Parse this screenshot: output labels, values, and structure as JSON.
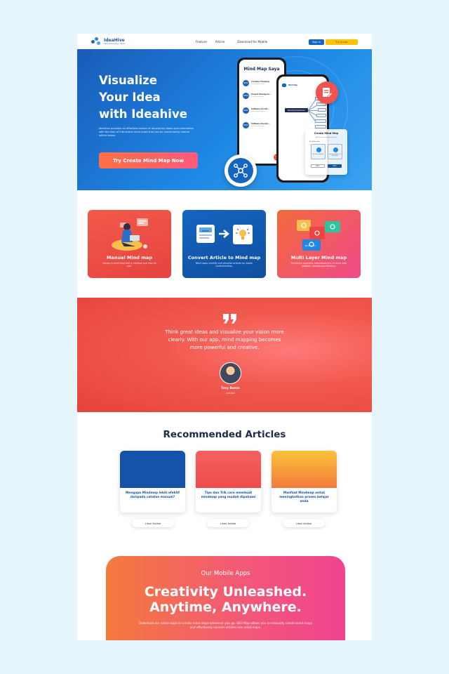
{
  "brand": {
    "name": "IdeaHive",
    "tagline": "Structure your mind",
    "accent": "#1565c0",
    "cta_color": "#ffc107"
  },
  "nav": {
    "links": [
      "Feature",
      "Article",
      "Download for Mobile"
    ],
    "signin_label": "Sign in",
    "try_label": "Try it now"
  },
  "hero": {
    "title_lines": [
      "Visualize",
      "Your Idea",
      "with Ideahive"
    ],
    "description": "IdeaHive provides an effortless means of structuring ideas and information with the help of interactive mind maps that can be conveniently shared within teams.",
    "cta_label": "Try Create Mind Map Now",
    "phone_list": {
      "title": "Mind Map Saya",
      "items": [
        {
          "badge": "MIND",
          "title": "Creative Planning",
          "sub": "Lorem ipsum dolor"
        },
        {
          "badge": "MIND",
          "title": "Project Managem...",
          "sub": "Lorem ipsum dolor"
        },
        {
          "badge": "MIND",
          "title": "Software Archit...",
          "sub": "Lorem ipsum dolor"
        },
        {
          "badge": "MIND",
          "title": "Software Develo...",
          "sub": "Lorem ipsum dolor"
        }
      ]
    },
    "phone_map": {
      "header": "Mind Map",
      "center_node": "Marketing Department"
    },
    "dialog": {
      "title": "Create Mind Map",
      "subtitle": "Type to start planning the path",
      "label": "Pick Mind map",
      "option_1": "Generate Manual",
      "option_2": "Generate Article to Mind map",
      "back_label": "Back",
      "next_label": "Next"
    }
  },
  "features": [
    {
      "title": "Manual Mind map",
      "desc": "Design a mind map that is intuitive and easy to use."
    },
    {
      "title": "Convert Article to Mind map",
      "desc": "Mind maps simplify and visualize articles for easier understanding."
    },
    {
      "title": "Multi Layer Mind map",
      "desc": "Facilitates seamless interconnection of mind map projects, increasing efficiency."
    }
  ],
  "feature_illustrations": {
    "news_label": "NEWS",
    "layer_label": "Mind map 1"
  },
  "quote": {
    "text": "Think great ideas and visualize your vision more clearly. With our app, mind mapping becomes more powerful and creative.",
    "name": "Tony Buzan",
    "role": "Author"
  },
  "articles": {
    "section_title": "Recommended Articles",
    "items": [
      {
        "title": "Mengapa Mindmap lebih efektif daripada catatan manual?",
        "button": "Lihat Artikel",
        "color": "#1453a8"
      },
      {
        "title": "Tips dan Trik cara membuat mindmap yang mudah dipahami",
        "button": "Lihat Artikel",
        "color": "#f26060"
      },
      {
        "title": "Manfaat Mindmap untuk meningkatkan proses belajar anda",
        "button": "Lihat Artikel",
        "color": "#f8a83a"
      }
    ]
  },
  "mobile": {
    "subtitle": "Our Mobile Apps",
    "title_lines": [
      "Creativity Unleashed.",
      "Anytime, Anywhere."
    ],
    "description": "Download our native apps to create mind maps wherever you go. SEO Map allows you to manually create mind maps and effortlessly convert articles into mind maps."
  }
}
